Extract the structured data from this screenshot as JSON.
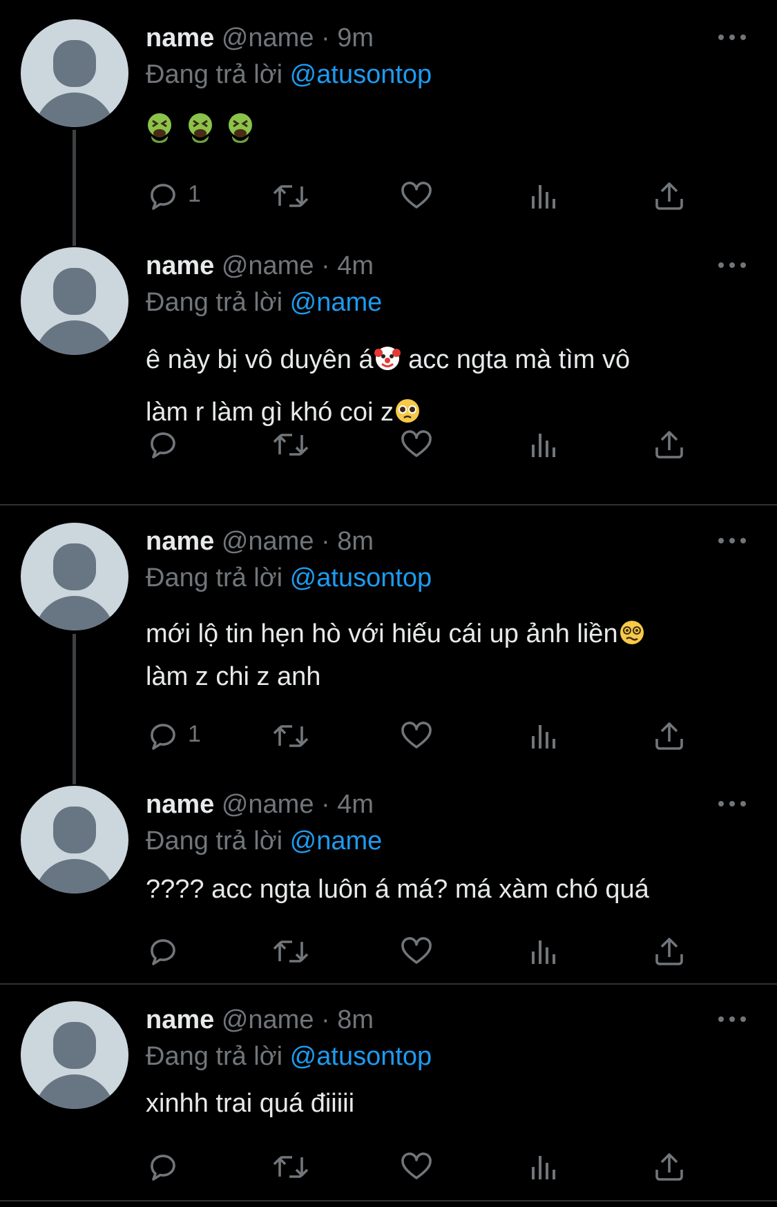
{
  "tweets": [
    {
      "name": "name",
      "handle": "@name",
      "dot": "·",
      "time": "9m",
      "reply_prefix": "Đang trả lời",
      "reply_to": "@atusontop",
      "text_lines": [
        ""
      ],
      "emojis": [
        "vomiting-face",
        "vomiting-face",
        "vomiting-face"
      ],
      "reply_count": "1"
    },
    {
      "name": "name",
      "handle": "@name",
      "dot": "·",
      "time": "4m",
      "reply_prefix": "Đang trả lời",
      "reply_to": "@name",
      "text_line1_a": "ê này bị vô duyên á",
      "text_line1_b": " acc ngta mà tìm vô",
      "text_line2": "làm r làm gì khó coi z",
      "emojis": [
        "clown-face",
        "pleading-face"
      ],
      "reply_count": ""
    },
    {
      "name": "name",
      "handle": "@name",
      "dot": "·",
      "time": "8m",
      "reply_prefix": "Đang trả lời",
      "reply_to": "@atusontop",
      "text_line1": "mới lộ tin hẹn hò với hiếu cái up ảnh liền",
      "text_line2": "làm z chi z anh",
      "emojis": [
        "dizzy-face"
      ],
      "reply_count": "1"
    },
    {
      "name": "name",
      "handle": "@name",
      "dot": "·",
      "time": "4m",
      "reply_prefix": "Đang trả lời",
      "reply_to": "@name",
      "text_line1": "???? acc ngta luôn á má? má xàm chó quá",
      "reply_count": ""
    },
    {
      "name": "name",
      "handle": "@name",
      "dot": "·",
      "time": "8m",
      "reply_prefix": "Đang trả lời",
      "reply_to": "@atusontop",
      "text_line1": "xinhh trai quá điiiii",
      "reply_count": ""
    }
  ],
  "icons": {
    "more": "more-horizontal-icon",
    "reply": "reply-bubble-icon",
    "retweet": "retweet-icon",
    "like": "heart-icon",
    "views": "views-bar-chart-icon",
    "share": "share-upload-icon"
  },
  "colors": {
    "background": "#000000",
    "mention": "#1d9bf0",
    "muted": "#71767b",
    "avatar_bg": "#ccd6dd",
    "avatar_fg": "#687684"
  }
}
